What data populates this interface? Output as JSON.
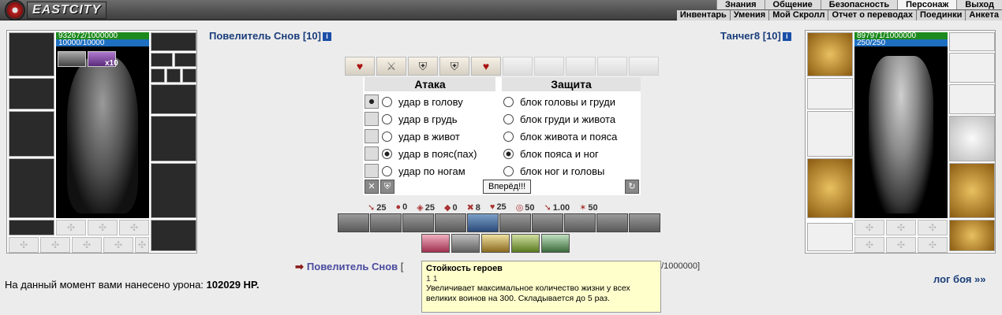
{
  "header": {
    "logo_text": "EASTCITY",
    "menu_top": [
      "Знания",
      "Общение",
      "Безопасность",
      "Персонаж",
      "Выход"
    ],
    "menu_sub": [
      "Инвентарь",
      "Умения",
      "Мой Скролл",
      "Отчет о переводах",
      "Поединки",
      "Анкета"
    ]
  },
  "player": {
    "name": "Повелитель Снов [10]",
    "hp": "932672/1000000",
    "mp": "10000/10000",
    "buff_count": "x10"
  },
  "enemy": {
    "name": "Танчег8 [10]",
    "hp": "897971/1000000",
    "mp": "250/250"
  },
  "combat": {
    "attack_title": "Атака",
    "defense_title": "Защита",
    "attacks": [
      "удар в голову",
      "удар в грудь",
      "удар в живот",
      "удар в пояс(пах)",
      "удар по ногам"
    ],
    "blocks": [
      "блок головы и груди",
      "блок груди и живота",
      "блок живота и пояса",
      "блок пояса и ног",
      "блок ног и головы"
    ],
    "selected_attack": 3,
    "selected_block": 3,
    "go_button": "Вперёд!!!"
  },
  "stats": {
    "items": [
      "25",
      "0",
      "25",
      "0",
      "8",
      "25",
      "50",
      "1.00",
      "50"
    ]
  },
  "turn": {
    "name": "Повелитель Снов",
    "bracket": "[",
    "hp_suffix": "1/1000000]"
  },
  "damage": {
    "label": "На данный момент вами нанесено урона:",
    "value": "102029 HP."
  },
  "log_link": "лог боя »»",
  "tooltip": {
    "title": "Стойкость героев",
    "stats": "1   1",
    "text": "Увеличивает максимальное количество жизни у всех великих воинов на 300. Складывается до 5 раз."
  }
}
